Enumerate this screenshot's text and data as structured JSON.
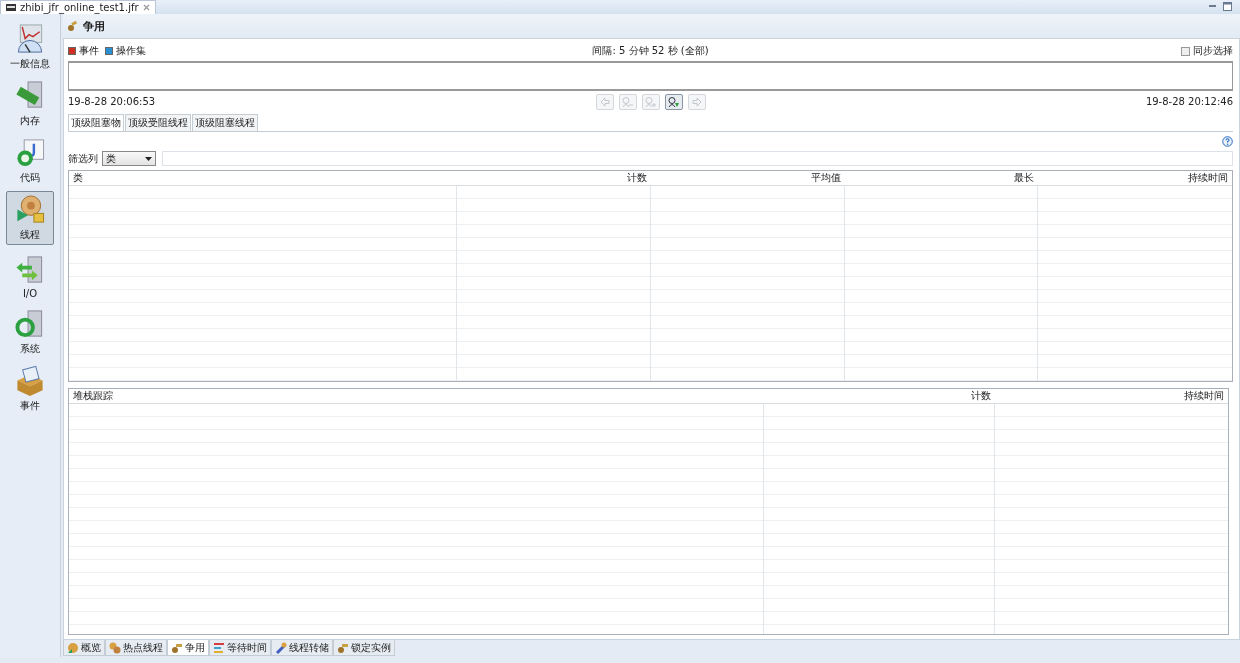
{
  "editor_tab": {
    "title": "zhibi_jfr_online_test1.jfr"
  },
  "sidebar": {
    "items": [
      {
        "label": "一般信息",
        "kind": "overview",
        "selected": false
      },
      {
        "label": "内存",
        "kind": "memory",
        "selected": false
      },
      {
        "label": "代码",
        "kind": "code",
        "selected": false
      },
      {
        "label": "线程",
        "kind": "threads",
        "selected": true
      },
      {
        "label": "I/O",
        "kind": "io",
        "selected": false
      },
      {
        "label": "系统",
        "kind": "system",
        "selected": false
      },
      {
        "label": "事件",
        "kind": "events",
        "selected": false
      }
    ]
  },
  "page": {
    "title": "争用"
  },
  "legend": [
    {
      "label": "事件",
      "color": "#d03020"
    },
    {
      "label": "操作集",
      "color": "#2a90d0"
    }
  ],
  "range_label": "间隔: 5 分钟 52 秒 (全部)",
  "sync_selection": {
    "label": "同步选择",
    "checked": false
  },
  "start_time": "19-8-28 20:06:53",
  "end_time": "19-8-28 20:12:46",
  "toolbar": [
    {
      "kind": "back",
      "disabled": true
    },
    {
      "kind": "zoom-out",
      "disabled": true
    },
    {
      "kind": "zoom-in",
      "disabled": true
    },
    {
      "kind": "zoom-fit",
      "disabled": false
    },
    {
      "kind": "forward",
      "disabled": true
    }
  ],
  "subtabs": [
    {
      "label": "顶级阻塞物",
      "selected": true
    },
    {
      "label": "顶级受阻线程",
      "selected": false
    },
    {
      "label": "顶级阻塞线程",
      "selected": false
    }
  ],
  "filter": {
    "label": "筛选列",
    "value": "类"
  },
  "table": {
    "columns": [
      "类",
      "计数",
      "平均值",
      "最长",
      "持续时间"
    ]
  },
  "stack_table": {
    "columns": [
      "堆栈跟踪",
      "计数",
      "持续时间"
    ]
  },
  "bottom_tabs": [
    {
      "label": "概览",
      "kind": "overview",
      "selected": false
    },
    {
      "label": "热点线程",
      "kind": "hot",
      "selected": false
    },
    {
      "label": "争用",
      "kind": "contention",
      "selected": true
    },
    {
      "label": "等待时间",
      "kind": "wait",
      "selected": false
    },
    {
      "label": "线程转储",
      "kind": "dump",
      "selected": false
    },
    {
      "label": "锁定实例",
      "kind": "lock",
      "selected": false
    }
  ]
}
